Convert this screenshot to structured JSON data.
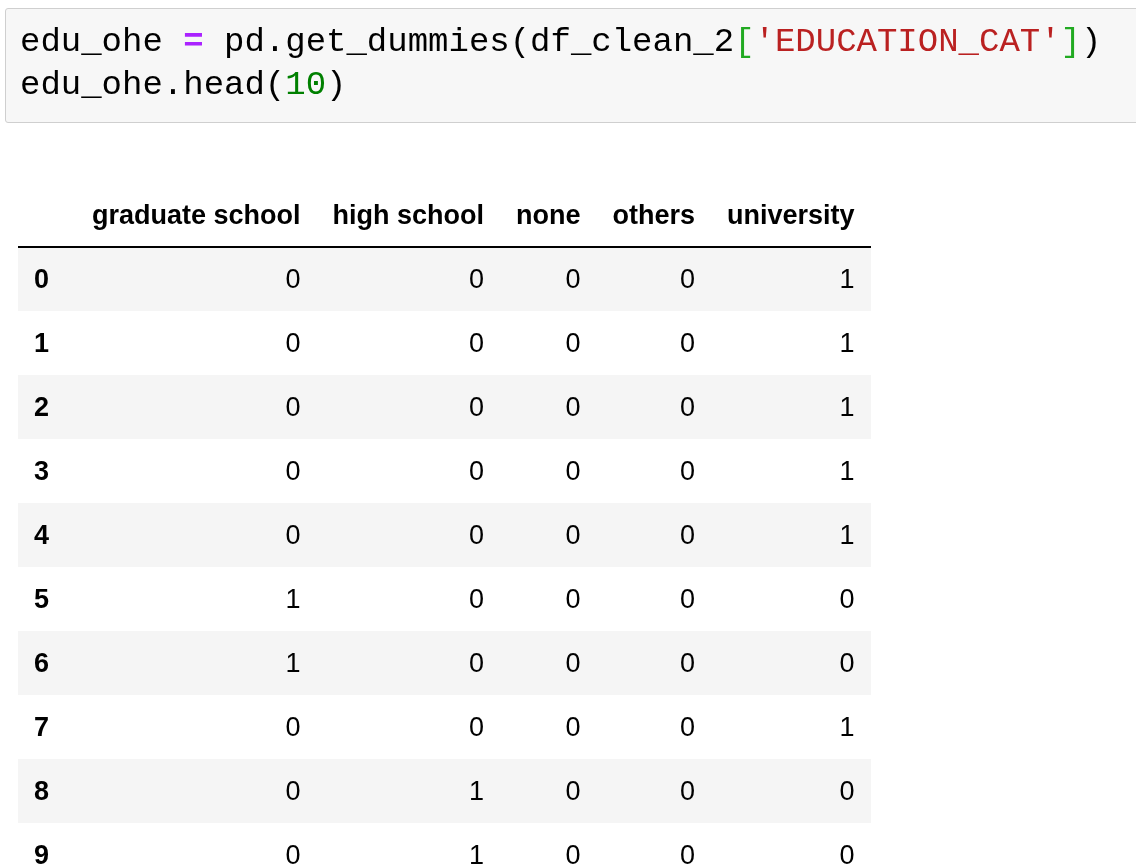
{
  "code_cell": {
    "lines": [
      [
        {
          "kind": "name",
          "text": "edu_ohe "
        },
        {
          "kind": "operator",
          "text": "="
        },
        {
          "kind": "name",
          "text": " pd.get_dummies(df_clean_2"
        },
        {
          "kind": "bracket",
          "text": "["
        },
        {
          "kind": "string",
          "text": "'EDUCATION_CAT'"
        },
        {
          "kind": "bracket",
          "text": "]"
        },
        {
          "kind": "name",
          "text": ")"
        }
      ],
      [
        {
          "kind": "name",
          "text": "edu_ohe.head("
        },
        {
          "kind": "number",
          "text": "10"
        },
        {
          "kind": "name",
          "text": ")"
        }
      ]
    ]
  },
  "table": {
    "columns": [
      "",
      "graduate school",
      "high school",
      "none",
      "others",
      "university"
    ],
    "rows": [
      [
        "0",
        "0",
        "0",
        "0",
        "0",
        "1"
      ],
      [
        "1",
        "0",
        "0",
        "0",
        "0",
        "1"
      ],
      [
        "2",
        "0",
        "0",
        "0",
        "0",
        "1"
      ],
      [
        "3",
        "0",
        "0",
        "0",
        "0",
        "1"
      ],
      [
        "4",
        "0",
        "0",
        "0",
        "0",
        "1"
      ],
      [
        "5",
        "1",
        "0",
        "0",
        "0",
        "0"
      ],
      [
        "6",
        "1",
        "0",
        "0",
        "0",
        "0"
      ],
      [
        "7",
        "0",
        "0",
        "0",
        "0",
        "1"
      ],
      [
        "8",
        "0",
        "1",
        "0",
        "0",
        "0"
      ],
      [
        "9",
        "0",
        "1",
        "0",
        "0",
        "0"
      ]
    ]
  }
}
